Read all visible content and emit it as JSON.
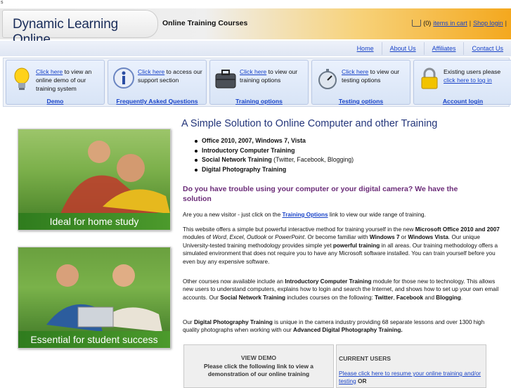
{
  "corner_mark": "s",
  "header": {
    "brand": "Dynamic Learning Online",
    "tagline": "Online Training Courses",
    "cart": {
      "count": "(0)",
      "items_link": "items in cart",
      "separator": "|",
      "shop_login": "Shop login",
      "end_sep": "|"
    }
  },
  "nav": {
    "items": [
      "Home",
      "About Us",
      "Affiliates",
      "Contact Us"
    ]
  },
  "features": [
    {
      "icon": "lightbulb-icon",
      "link": "Click here",
      "text": " to view an online demo of our training system",
      "footer": "Demo"
    },
    {
      "icon": "info-icon",
      "link": "Click here",
      "text": " to access our support section",
      "footer": "Frequently Asked Questions"
    },
    {
      "icon": "briefcase-icon",
      "link": "Click here",
      "text": " to view our training options",
      "footer": "Training options"
    },
    {
      "icon": "stopwatch-icon",
      "link": "Click here",
      "text": " to view our testing options",
      "footer": "Testing options"
    },
    {
      "icon": "padlock-icon",
      "pre": "Existing users please ",
      "link": "click here to log in",
      "footer": "Account login"
    }
  ],
  "photos": [
    {
      "caption": "Ideal for home study"
    },
    {
      "caption": "Essential for student success"
    }
  ],
  "main": {
    "title": "A Simple Solution to Online Computer and other Training",
    "bullets": [
      {
        "bold": "Office 2010, 2007, Windows 7, Vista",
        "rest": ""
      },
      {
        "bold": "Introductory Computer Training",
        "rest": ""
      },
      {
        "bold": "Social Network Training",
        "rest": " (Twitter, Facebook, Blogging)"
      },
      {
        "bold": "Digital Photography Training",
        "rest": ""
      }
    ],
    "question": "Do you have trouble using your computer or your digital camera? We have the solution",
    "p1": {
      "a": "Are you a new visitor - just click on the ",
      "link": "Training Options",
      "b": " link to view our wide range of training."
    },
    "p2": {
      "a": "This website offers a simple but powerful interactive method for training yourself in the new ",
      "b1": "Microsoft Office 2010 and 2007",
      "c": " modules of ",
      "i1": "Word",
      "d": ", ",
      "i2": "Excel",
      "e": ", ",
      "i3": "Outlook",
      "f": " or ",
      "i4": "PowerPoint",
      "g": ". Or become familiar with ",
      "b2": "Windows 7",
      "h": " or ",
      "b3": "Windows Vista",
      "j": ". Our unique University-tested training methodology provides simple yet ",
      "b4": "powerful training",
      "k": " in all areas. Our training methodology offers a simulated environment that does not require you to have any Microsoft software installed. You can train yourself before you even buy any expensive software."
    },
    "p3": {
      "a": "Other courses now available include an ",
      "b1": "Introductory Computer Training",
      "c": " module for those new to technology. This allows new users to understand computers, explains how to login and search the Internet, and shows how to set up your own email accounts. Our ",
      "b2": "Social Network Training",
      "d": " includes courses on the following: ",
      "b3": "Twitter",
      "e": ", ",
      "b4": "Facebook",
      "f": " and ",
      "b5": "Blogging",
      "g": "."
    },
    "p4": {
      "a": "Our ",
      "b1": "Digital Photography Training",
      "c": " is unique in the camera industry providing 68 separate lessons and over 1300 high quality photographs when working with our ",
      "b2": "Advanced Digital Photography Training.",
      "d": ""
    }
  },
  "panels": {
    "demo": {
      "title": "VIEW DEMO",
      "text": "Please click the following link to view a demonstration of our online training"
    },
    "users": {
      "title": "CURRENT USERS",
      "link": "Please click here to resume your online training and/or testing",
      "after": " OR"
    }
  }
}
